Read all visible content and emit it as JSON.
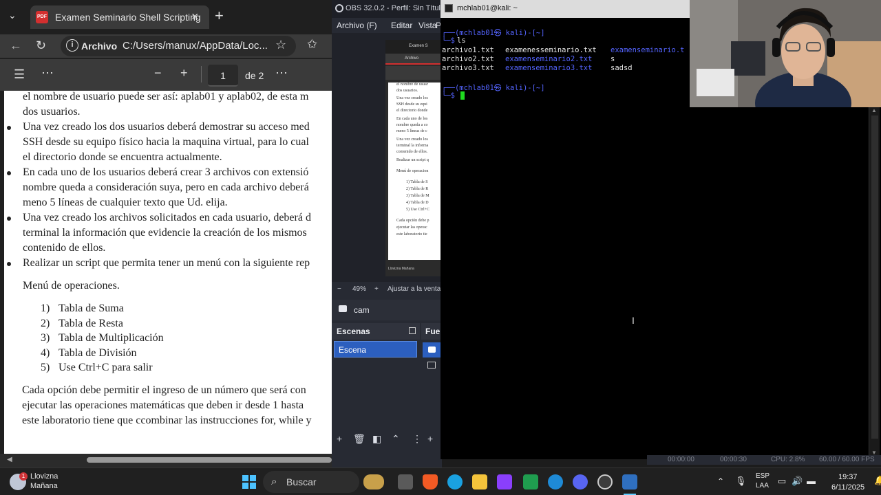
{
  "browser": {
    "tab_title": "Examen Seminario Shell Scripting",
    "address_label": "Archivo",
    "address_url": "C:/Users/manux/AppData/Loc...",
    "page_current": "1",
    "page_total": "de 2",
    "zoom_out": "−",
    "zoom_in": "+"
  },
  "pdf": {
    "lines": [
      "el nombre de usuario puede ser así: aplab01 y aplab02, de esta m",
      "dos usuarios.",
      "Una vez creado los dos usuarios deberá demostrar su acceso med",
      "SSH desde su equipo físico hacia la maquina virtual, para lo cual",
      "el directorio donde se encuentra actualmente.",
      "En cada uno de los usuarios deberá crear 3 archivos con extensió",
      "nombre queda a consideración suya, pero en cada archivo deberá",
      "meno 5 líneas de cualquier texto que Ud. elija.",
      "Una vez creado los archivos solicitados en cada usuario, deberá d",
      "terminal la información que evidencie la creación de los mismos",
      "contenido de ellos.",
      "Realizar un script que permita tener un menú con la siguiente rep"
    ],
    "menu_title": "Menú de operaciones.",
    "menu_items": [
      {
        "num": "1)",
        "text": "Tabla de Suma"
      },
      {
        "num": "2)",
        "text": "Tabla de Resta"
      },
      {
        "num": "3)",
        "text": "Tabla de Multiplicación"
      },
      {
        "num": "4)",
        "text": "Tabla de División"
      },
      {
        "num": "5)",
        "text": "Use Ctrl+C para salir"
      }
    ],
    "closing": [
      "Cada opción debe permitir el ingreso de un número que será con",
      "ejecutar las operaciones matemáticas que deben ir desde 1 hasta",
      "este laboratorio tiene que ccombinar las instrucciones for, while y"
    ]
  },
  "obs": {
    "title": "OBS 32.0.2 - Perfil: Sin Título",
    "menu": [
      "Archivo (F)",
      "Editar",
      "Vista",
      "P"
    ],
    "zoom_minus": "−",
    "zoom_level": "49%",
    "zoom_plus": "+",
    "zoom_fit": "Ajustar a la ventan",
    "source_name": "cam",
    "scenes_header": "Escenas",
    "scene_item": "Escena",
    "sources_header": "Fuen",
    "preview": {
      "tab": "Examen S",
      "addr": "Archivo",
      "lines": [
        "el nombre de usuar",
        "dos usuarios.",
        "Una vez creado los",
        "SSH desde su equi",
        "el directorio donde",
        "En cada uno de los",
        "nombre queda a co",
        "meno 5 líneas de c",
        "Una vez creado los",
        "terminal la informa",
        "contenido de ellos.",
        "Realizar un script q",
        "Menú de operacion",
        "1)   Tabla de S",
        "2)   Tabla de R",
        "3)   Tabla de M",
        "4)   Tabla de D",
        "5)   Use Ctrl+C",
        "Cada opción debe p",
        "ejecutar las operac",
        "este laboratorio tie"
      ],
      "footer": "Llovizna Mañana"
    },
    "status": [
      "00:00:00",
      "00:00:30",
      "CPU: 2.8%",
      "60.00 / 60.00 FPS"
    ]
  },
  "terminal": {
    "title": "mchlab01@kali: ~",
    "prompt1_top": "┌──(mchlab01㉿ kali)-[~]",
    "prompt1_cmd_prefix": "└─$",
    "prompt1_cmd": " ls",
    "ls_rows": [
      [
        "archivo1.txt",
        "examenesseminario.txt",
        "examenseminario.t"
      ],
      [
        "archivo2.txt",
        "examenseminario2.txt",
        "s"
      ],
      [
        "archivo3.txt",
        "examenseminario3.txt",
        "sadsd"
      ]
    ],
    "prompt2_top": "┌──(mchlab01㉿ kali)-[~]",
    "prompt2_prefix": "└─$"
  },
  "taskbar": {
    "weather_line1": "Llovizna",
    "weather_line2": "Mañana",
    "weather_badge": "1",
    "search": "Buscar",
    "lang1": "ESP",
    "lang2": "LAA",
    "time": "19:37",
    "date": "6/11/2025"
  }
}
